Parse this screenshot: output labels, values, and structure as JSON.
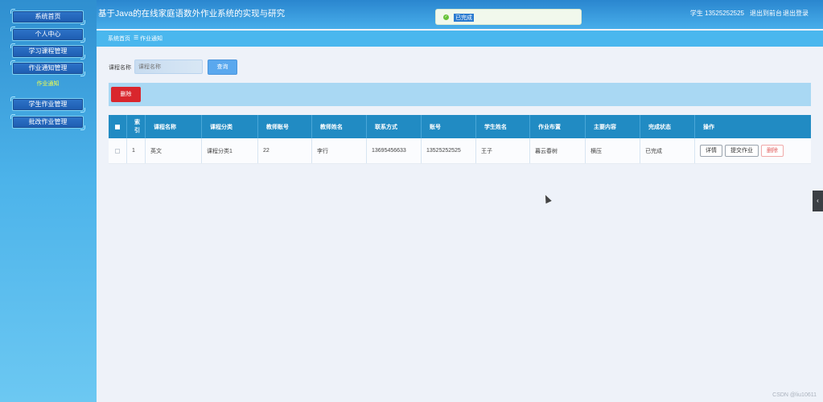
{
  "sidebar": {
    "items": [
      {
        "label": "系统首页"
      },
      {
        "label": "个人中心"
      },
      {
        "label": "学习课程管理"
      },
      {
        "label": "作业通知管理"
      },
      {
        "label": "学生作业管理"
      },
      {
        "label": "批改作业管理"
      }
    ],
    "active_sub": "作业通知"
  },
  "header": {
    "title": "基于Java的在线家庭语数外作业系统的实现与研究",
    "user": "学生 13525252525",
    "back_front": "退出到前台",
    "logout": "退出登录"
  },
  "toast": {
    "message": "已完成"
  },
  "breadcrumb": {
    "home": "系统首页",
    "sep": "☰",
    "current": "作业通知"
  },
  "search": {
    "label": "课程名称",
    "placeholder": "课程名称",
    "value": "",
    "button": "查询"
  },
  "actions": {
    "delete": "删除"
  },
  "table": {
    "columns": [
      "索引",
      "课程名称",
      "课程分类",
      "教师账号",
      "教师姓名",
      "联系方式",
      "账号",
      "学生姓名",
      "作业布置",
      "主要内容",
      "完成状态",
      "操作"
    ],
    "rows": [
      {
        "index": "1",
        "course_name": "英文",
        "course_category": "课程分类1",
        "teacher_account": "22",
        "teacher_name": "李行",
        "phone": "13695456633",
        "account": "13525252525",
        "student_name": "王子",
        "assignment": "暮云春树",
        "content": "横压",
        "status": "已完成",
        "ops": {
          "detail": "详情",
          "submit": "提交作业",
          "delete": "删除"
        }
      }
    ]
  },
  "watermark": "CSDN @liu10611",
  "colors": {
    "header_blue": "#2a86cf",
    "table_head": "#218bc3",
    "danger": "#d9262d",
    "accent": "#5aa8ee"
  }
}
